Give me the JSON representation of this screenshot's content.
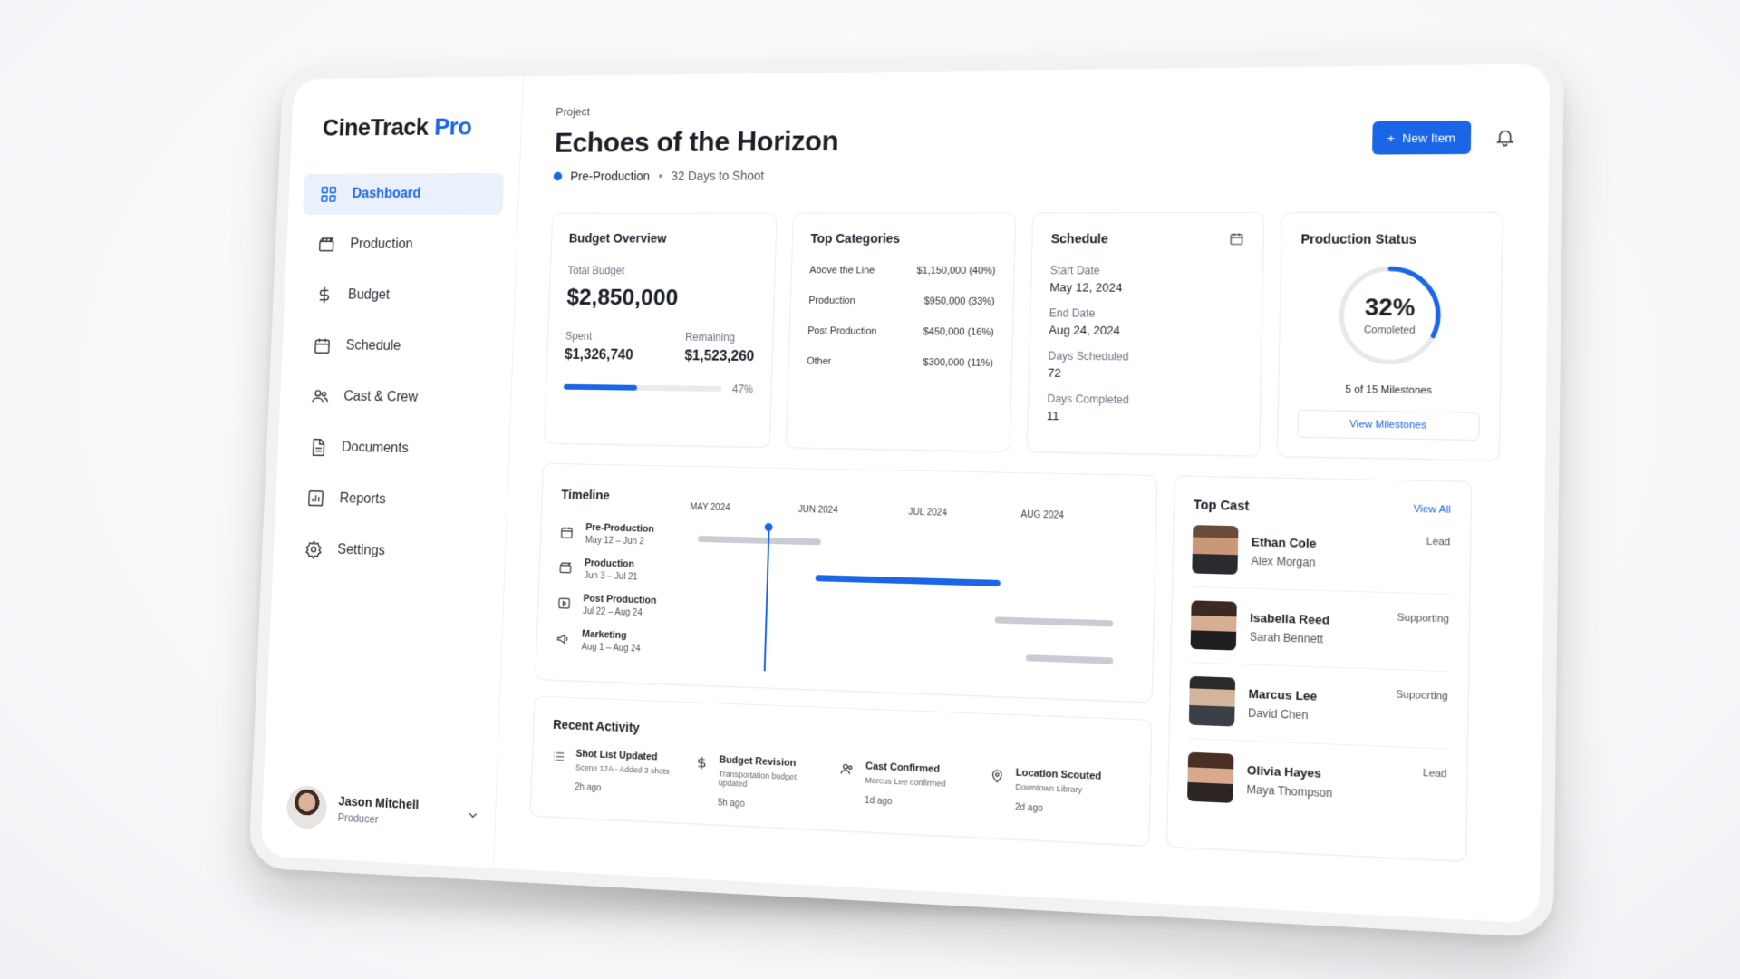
{
  "app": {
    "name": "CineTrack",
    "name_suffix": "Pro"
  },
  "sidebar": {
    "items": [
      {
        "label": "Dashboard",
        "icon": "grid-icon",
        "active": true
      },
      {
        "label": "Production",
        "icon": "clapperboard-icon"
      },
      {
        "label": "Budget",
        "icon": "dollar-icon"
      },
      {
        "label": "Schedule",
        "icon": "calendar-icon"
      },
      {
        "label": "Cast & Crew",
        "icon": "users-icon"
      },
      {
        "label": "Documents",
        "icon": "document-icon"
      },
      {
        "label": "Reports",
        "icon": "chart-icon"
      },
      {
        "label": "Settings",
        "icon": "gear-icon"
      }
    ],
    "user": {
      "name": "Jason Mitchell",
      "role": "Producer"
    }
  },
  "header": {
    "label": "Project",
    "title": "Echoes of the Horizon",
    "phase": "Pre-Production",
    "separator": "•",
    "countdown": "32 Days to Shoot",
    "new_button": "New Item"
  },
  "budget": {
    "title": "Budget Overview",
    "total_label": "Total Budget",
    "total": "$2,850,000",
    "spent_label": "Spent",
    "spent": "$1,326,740",
    "remaining_label": "Remaining",
    "remaining": "$1,523,260",
    "progress_label": "47%",
    "progress": 0.47
  },
  "categories": {
    "title": "Top Categories",
    "rows": [
      {
        "name": "Above the Line",
        "value": "$1,150,000 (40%)"
      },
      {
        "name": "Production",
        "value": "$950,000 (33%)"
      },
      {
        "name": "Post Production",
        "value": "$450,000 (16%)"
      },
      {
        "name": "Other",
        "value": "$300,000 (11%)"
      }
    ]
  },
  "schedule": {
    "title": "Schedule",
    "items": [
      {
        "label": "Start Date",
        "value": "May 12, 2024"
      },
      {
        "label": "End Date",
        "value": "Aug 24, 2024"
      },
      {
        "label": "Days Scheduled",
        "value": "72"
      },
      {
        "label": "Days Completed",
        "value": "11"
      }
    ]
  },
  "status": {
    "title": "Production Status",
    "percent": "32%",
    "percent_value": 0.32,
    "completed_label": "Completed",
    "milestones": "5 of 15 Milestones",
    "button": "View Milestones",
    "accent": "#1a66e6"
  },
  "timeline": {
    "title": "Timeline",
    "months": [
      "MAY 2024",
      "JUN 2024",
      "JUL 2024",
      "AUG 2024"
    ],
    "phases": [
      {
        "name": "Pre-Production",
        "dates": "May 12 – Jun 2",
        "icon": "calendar-icon"
      },
      {
        "name": "Production",
        "dates": "Jun 3 – Jul 21",
        "icon": "clapperboard-icon"
      },
      {
        "name": "Post Production",
        "dates": "Jul 22 – Aug 24",
        "icon": "play-icon"
      },
      {
        "name": "Marketing",
        "dates": "Aug 1 – Aug 24",
        "icon": "megaphone-icon"
      }
    ]
  },
  "cast": {
    "title": "Top Cast",
    "view_all": "View All",
    "members": [
      {
        "character": "Ethan Cole",
        "actor": "Alex Morgan",
        "role": "Lead"
      },
      {
        "character": "Isabella Reed",
        "actor": "Sarah Bennett",
        "role": "Supporting"
      },
      {
        "character": "Marcus Lee",
        "actor": "David Chen",
        "role": "Supporting"
      },
      {
        "character": "Olivia Hayes",
        "actor": "Maya Thompson",
        "role": "Lead"
      }
    ]
  },
  "activity": {
    "title": "Recent Activity",
    "items": [
      {
        "title": "Shot List Updated",
        "sub": "Scene 12A - Added 3 shots",
        "time": "2h ago",
        "icon": "list-icon"
      },
      {
        "title": "Budget Revision",
        "sub": "Transportation budget updated",
        "time": "5h ago",
        "icon": "dollar-icon"
      },
      {
        "title": "Cast Confirmed",
        "sub": "Marcus Lee confirmed",
        "time": "1d ago",
        "icon": "users-icon"
      },
      {
        "title": "Location Scouted",
        "sub": "Downtown Library",
        "time": "2d ago",
        "icon": "map-pin-icon"
      }
    ]
  }
}
